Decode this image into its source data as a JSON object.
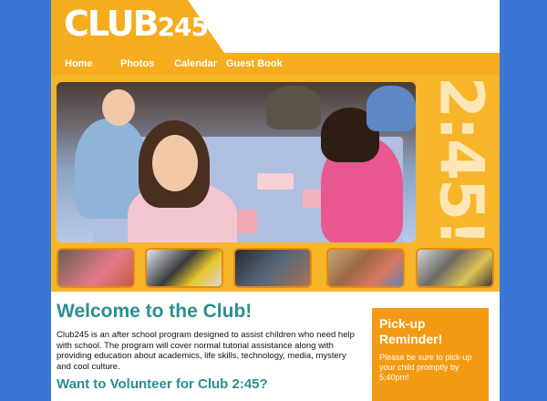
{
  "header": {
    "logo_word": "CLUB",
    "logo_num": "245"
  },
  "nav": {
    "items": [
      "Home",
      "Photos",
      "Calendar",
      "Guest Book"
    ]
  },
  "hero": {
    "time_text": "2:45!"
  },
  "main": {
    "heading": "Welcome to the Club!",
    "intro": "Club245 is an after school program designed to assist children who need help with school. The program will cover normal tutorial assistance along with providing education about academics, life skills, technology, media, mystery and cool culture.",
    "volunteer_heading": "Want to Volunteer for Club 2:45?"
  },
  "reminder": {
    "title": "Pick-up Reminder!",
    "body": "Please be sure to pick-up your child promptly by 5:40pm!"
  },
  "colors": {
    "background": "#3a76d6",
    "accent": "#f5ad1e",
    "heading": "#2a8f8f",
    "reminder": "#f39a14"
  },
  "icons": [
    "photo-thumbnail"
  ]
}
